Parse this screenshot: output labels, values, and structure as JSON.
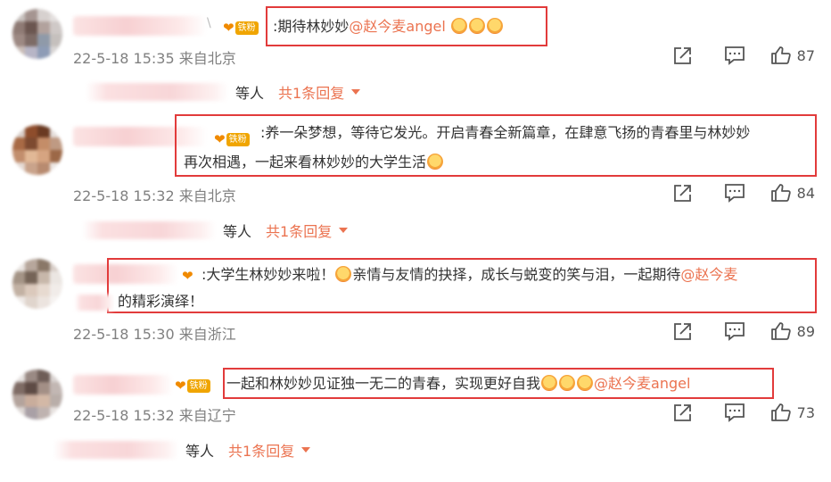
{
  "badge_label": "铁粉",
  "comments": [
    {
      "text_parts": [
        ":期待林妙妙",
        "@赵今麦angel"
      ],
      "meta": "22-5-18 15:35 来自北京",
      "likes": "87",
      "reply_suffix": "等人",
      "reply_count": "共1条回复"
    },
    {
      "text_line1": ":养一朵梦想，等待它发光。开启青春全新篇章，在肆意飞扬的青春里与林妙妙",
      "text_line2": "再次相遇，一起来看林妙妙的大学生活",
      "meta": "22-5-18 15:32 来自北京",
      "likes": "84",
      "reply_suffix": "等人",
      "reply_count": "共1条回复"
    },
    {
      "text_line1a": ":大学生林妙妙来啦！",
      "text_line1b": "亲情与友情的抉择，成长与蜕变的笑与泪，一起期待",
      "mention": "@赵今麦",
      "text_line2": "的精彩演绎！",
      "meta": "22-5-18 15:30 来自浙江",
      "likes": "89"
    },
    {
      "text_parts": [
        "一起和林妙妙见证独一无二的青春，实现更好自我",
        "@赵今麦angel"
      ],
      "meta": "22-5-18 15:32 来自辽宁",
      "likes": "73",
      "reply_suffix": "等人",
      "reply_count": "共1条回复"
    }
  ],
  "icons": {
    "forward": "forward-icon",
    "comment": "comment-icon",
    "like": "thumbs-up-icon",
    "fan": "fan-heart-icon"
  },
  "colors": {
    "mention": "#eb7350",
    "highlight_box": "#e23b3b",
    "meta": "#808080",
    "badge": "#f0a500"
  }
}
